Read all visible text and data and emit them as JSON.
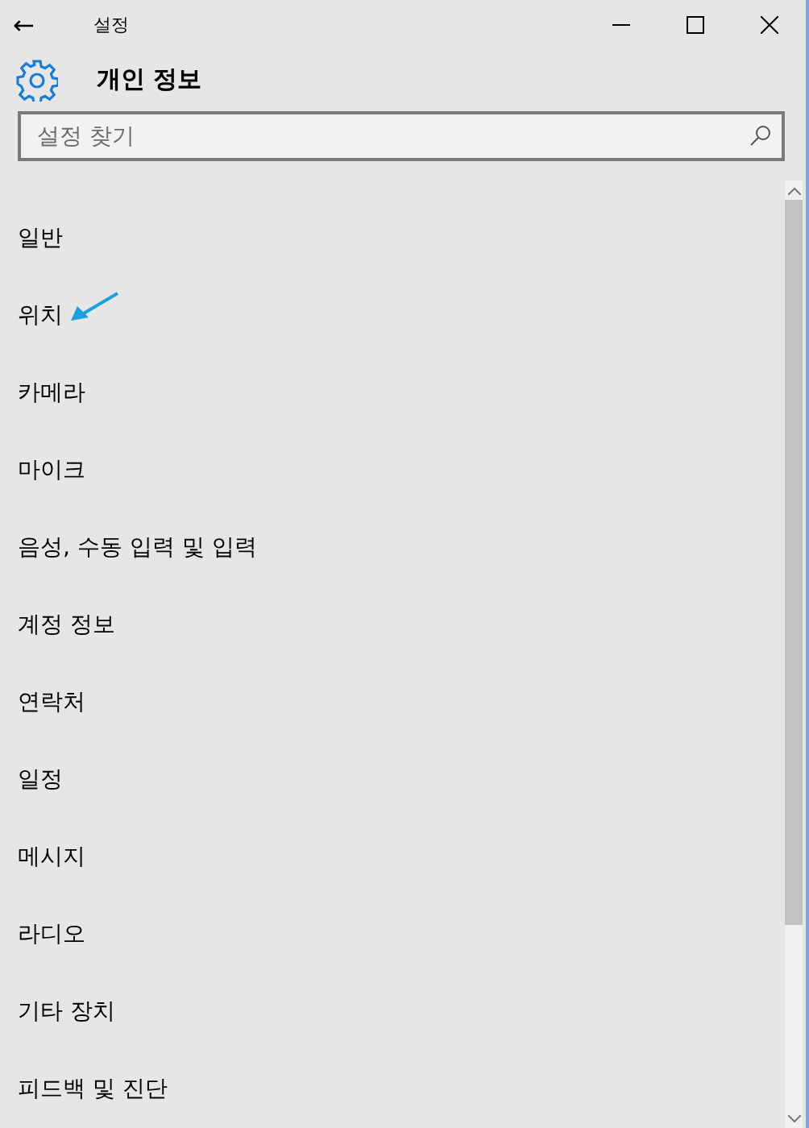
{
  "window": {
    "title": "설정",
    "back": "←"
  },
  "header": {
    "title": "개인 정보"
  },
  "search": {
    "placeholder": "설정 찾기"
  },
  "items": [
    {
      "label": "일반",
      "annotated": false
    },
    {
      "label": "위치",
      "annotated": true
    },
    {
      "label": "카메라",
      "annotated": false
    },
    {
      "label": "마이크",
      "annotated": false
    },
    {
      "label": "음성, 수동 입력 및 입력",
      "annotated": false
    },
    {
      "label": "계정 정보",
      "annotated": false
    },
    {
      "label": "연락처",
      "annotated": false
    },
    {
      "label": "일정",
      "annotated": false
    },
    {
      "label": "메시지",
      "annotated": false
    },
    {
      "label": "라디오",
      "annotated": false
    },
    {
      "label": "기타 장치",
      "annotated": false
    },
    {
      "label": "피드백 및 진단",
      "annotated": false
    }
  ]
}
